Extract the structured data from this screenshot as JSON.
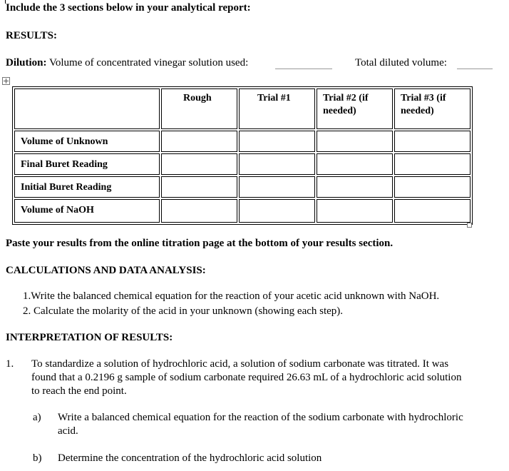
{
  "intro": "Include the 3 sections below in your analytical report:",
  "results_heading": "RESULTS:",
  "dilution": {
    "label": "Dilution:",
    "text": " Volume of concentrated vinegar solution used:",
    "total_label": "Total diluted volume:"
  },
  "table": {
    "headers": [
      "",
      "Rough",
      "Trial #1",
      "Trial #2 (if needed)",
      "Trial #3 (if needed)"
    ],
    "rows": [
      "Volume of Unknown",
      "Final Buret Reading",
      "Initial Buret Reading",
      "Volume of NaOH"
    ]
  },
  "paste_note": "Paste your results from the online titration page at the bottom of your results section.",
  "calc_heading": "CALCULATIONS AND DATA ANALYSIS:",
  "calc_items": [
    "1.Write the balanced chemical equation for the reaction of your acetic acid unknown with NaOH.",
    "2. Calculate the molarity of the acid in your unknown (showing each step)."
  ],
  "interp_heading": "INTERPRETATION OF RESULTS:",
  "question": {
    "number": "1.",
    "lines": [
      "To standardize a solution of hydrochloric acid, a solution of sodium carbonate was titrated. It was",
      "found that a 0.2196 g sample of sodium carbonate required 26.63 mL of a hydrochloric acid solution",
      "to reach the end point."
    ],
    "parts": [
      {
        "label": "a)",
        "lines": [
          "Write a balanced chemical equation for the reaction of the sodium carbonate with hydrochloric",
          "acid."
        ]
      },
      {
        "label": "b)",
        "lines": [
          "Determine the concentration of the hydrochloric acid solution"
        ]
      }
    ]
  }
}
